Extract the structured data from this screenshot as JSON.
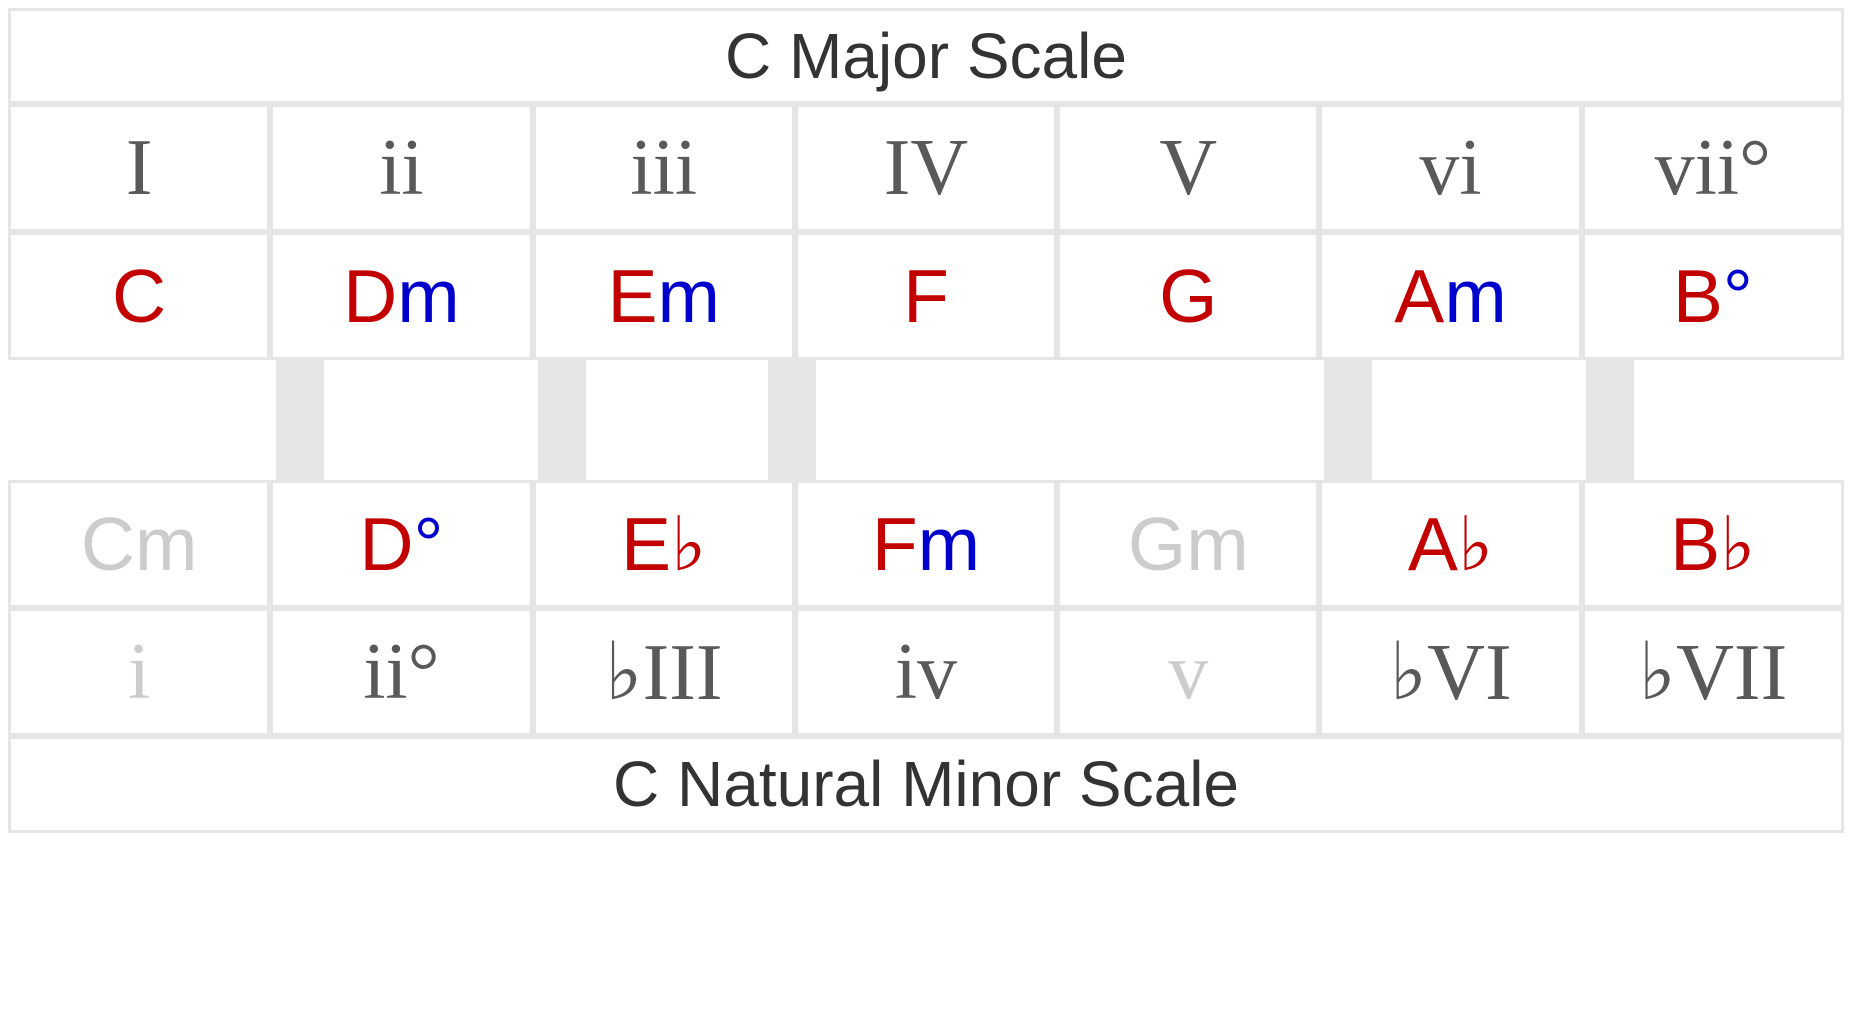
{
  "major": {
    "title": "C Major Scale",
    "roman": [
      "I",
      "ii",
      "iii",
      "IV",
      "V",
      "vi",
      "vii°"
    ],
    "chords": [
      {
        "root": "C",
        "qual": ""
      },
      {
        "root": "D",
        "qual": "m"
      },
      {
        "root": "E",
        "qual": "m"
      },
      {
        "root": "F",
        "qual": ""
      },
      {
        "root": "G",
        "qual": ""
      },
      {
        "root": "A",
        "qual": "m"
      },
      {
        "root": "B",
        "qual": "°"
      }
    ]
  },
  "minor": {
    "title": "C Natural Minor Scale",
    "roman": [
      "i",
      "ii°",
      "♭III",
      "iv",
      "v",
      "♭VI",
      "♭VII"
    ],
    "roman_faded": [
      true,
      false,
      false,
      false,
      true,
      false,
      false
    ],
    "chords": [
      {
        "root": "C",
        "qual": "m",
        "faded": true
      },
      {
        "root": "D",
        "qual": "°"
      },
      {
        "root": "E",
        "qual": "♭"
      },
      {
        "root": "F",
        "qual": "m"
      },
      {
        "root": "G",
        "qual": "m",
        "faded": true
      },
      {
        "root": "A",
        "qual": "♭"
      },
      {
        "root": "B",
        "qual": "♭"
      }
    ]
  }
}
